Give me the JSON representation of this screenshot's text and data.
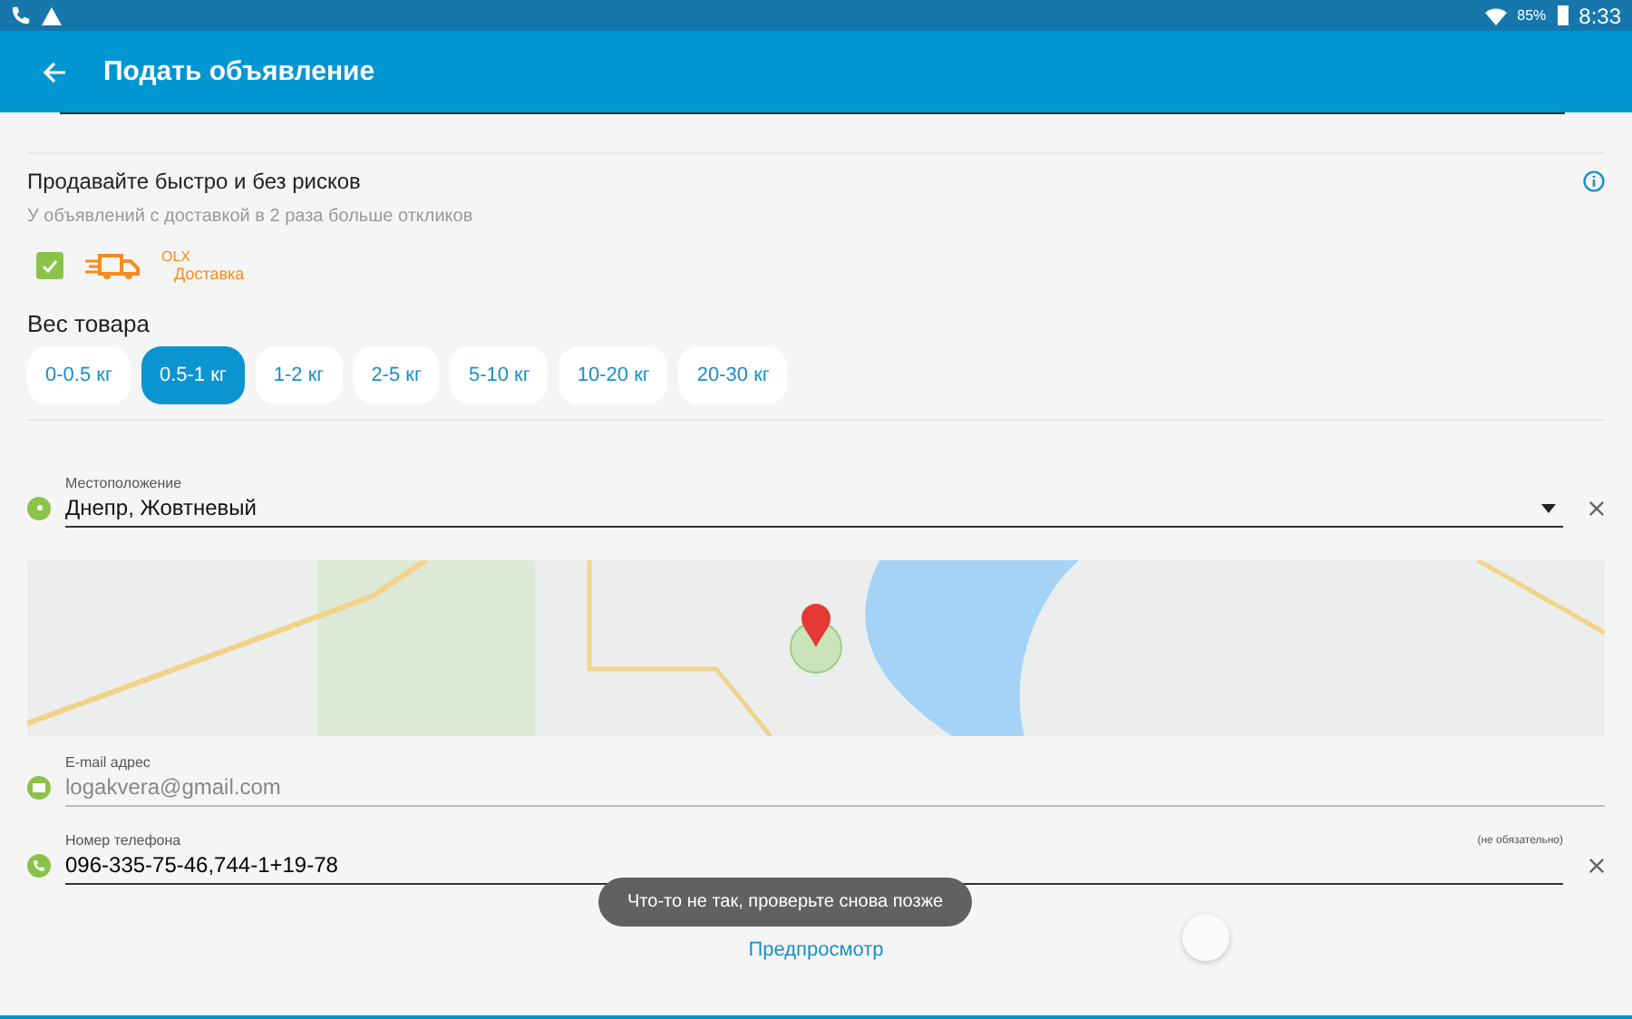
{
  "status_bar": {
    "battery": "85%",
    "time": "8:33"
  },
  "app_bar": {
    "title": "Подать объявление"
  },
  "delivery": {
    "title": "Продавайте быстро и без рисков",
    "subtitle": "У объявлений с доставкой в 2 раза больше откликов",
    "checked": true,
    "brand": "OLX",
    "service": "Доставка"
  },
  "weight": {
    "title": "Вес товара",
    "options": [
      {
        "label": "0-0.5 кг",
        "selected": false
      },
      {
        "label": "0.5-1 кг",
        "selected": true
      },
      {
        "label": "1-2 кг",
        "selected": false
      },
      {
        "label": "2-5 кг",
        "selected": false
      },
      {
        "label": "5-10 кг",
        "selected": false
      },
      {
        "label": "10-20 кг",
        "selected": false
      },
      {
        "label": "20-30 кг",
        "selected": false
      }
    ]
  },
  "location": {
    "label": "Местоположение",
    "value": "Днепр, Жовтневый"
  },
  "email": {
    "label": "E-mail адрес",
    "placeholder": "logakvera@gmail.com"
  },
  "phone": {
    "label": "Номер телефона",
    "hint": "(не обязательно)",
    "value": "096-335-75-46,744-1+19-78"
  },
  "toast": "Что-то не так, проверьте снова позже",
  "preview_link": "Предпросмотр"
}
